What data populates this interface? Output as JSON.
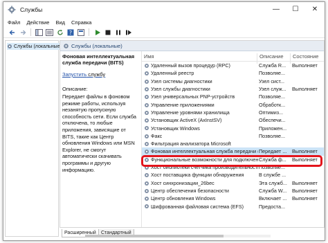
{
  "window": {
    "title": "Службы"
  },
  "titlebar_buttons": {
    "minimize": "—",
    "maximize": "☐",
    "close": "✕"
  },
  "menu": [
    "Файл",
    "Действие",
    "Вид",
    "Справка"
  ],
  "tree": {
    "item": "Службы (локальные"
  },
  "content": {
    "header": "Службы (локальные)",
    "description_panel": {
      "title": "Фоновая интеллектуальная служба передачи (BITS)",
      "start_link": "Запустить",
      "start_suffix": " службу",
      "label": "Описание:",
      "text": "Передает файлы в фоновом режиме работы, используя незанятую пропускную способность сети. Если служба отключена, то любые приложения, зависящие от BITS, такие как Центр обновления Windows или MSN Explorer, не смогут автоматически скачивать программы и другую информацию."
    },
    "columns": {
      "name": "Имя",
      "description": "Описание",
      "state": "Состояние"
    },
    "rows": [
      {
        "name": "Удаленный вызов процедур (RPC)",
        "description": "Служба R...",
        "state": "Выполняет"
      },
      {
        "name": "Удаленный реестр",
        "description": "Позволяе...",
        "state": ""
      },
      {
        "name": "Узел системы диагностики",
        "description": "Узел сист...",
        "state": ""
      },
      {
        "name": "Узел службы диагностики",
        "description": "Узел служ...",
        "state": "Выполняет"
      },
      {
        "name": "Узел универсальных PNP-устройств",
        "description": "Позволяе...",
        "state": ""
      },
      {
        "name": "Управление приложениями",
        "description": "Обработк...",
        "state": ""
      },
      {
        "name": "Управление уровнями хранилища",
        "description": "Оптимиз...",
        "state": ""
      },
      {
        "name": "Установщик ActiveX (AxInstSV)",
        "description": "Обеспечи...",
        "state": ""
      },
      {
        "name": "Установщик Windows",
        "description": "Приложен...",
        "state": ""
      },
      {
        "name": "Факс",
        "description": "Позволяе...",
        "state": ""
      },
      {
        "name": "Фильтрация анализатора Microsoft",
        "description": "",
        "state": ""
      },
      {
        "name": "Фоновая интеллектуальная служба передачи (...",
        "description": "Передает ...",
        "state": "Выполняет"
      },
      {
        "name": "Функциональные возможности для подключен...",
        "description": "Служба ф...",
        "state": "Выполняет"
      },
      {
        "name": "Хост библиотеки счетчика производительности",
        "description": "Позволяе...",
        "state": ""
      },
      {
        "name": "Хост поставщика функции обнаружения",
        "description": "В службе ...",
        "state": ""
      },
      {
        "name": "Хост синхронизации_26bec",
        "description": "Эта служб...",
        "state": "Выполняет"
      },
      {
        "name": "Центр обеспечения безопасности",
        "description": "Служба W...",
        "state": "Выполняет"
      },
      {
        "name": "Центр обновления Windows",
        "description": "Включает ...",
        "state": "Выполняет"
      },
      {
        "name": "Шифрованная файловая система (EFS)",
        "description": "Предоста...",
        "state": ""
      }
    ],
    "selected_row": 11
  },
  "tabs": [
    "Расширенный",
    "Стандартный"
  ],
  "colors": {
    "highlight": "#e3141c",
    "selection": "#cce4f7",
    "header_bg": "#e7ecf3",
    "link": "#1f4fa8"
  }
}
